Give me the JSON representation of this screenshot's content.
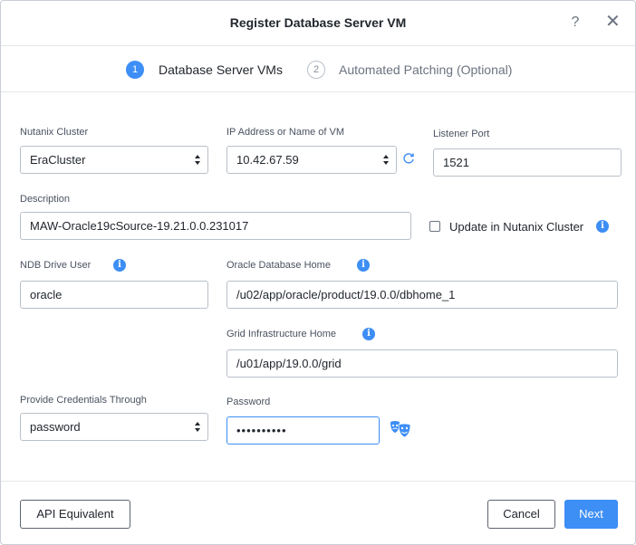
{
  "dialog": {
    "title": "Register Database Server VM",
    "help": "?",
    "close": "✕"
  },
  "steps": [
    {
      "number": "1",
      "label": "Database Server VMs",
      "active": true
    },
    {
      "number": "2",
      "label": "Automated Patching (Optional)",
      "active": false
    }
  ],
  "form": {
    "cluster": {
      "label": "Nutanix Cluster",
      "value": "EraCluster"
    },
    "ip": {
      "label": "IP Address or Name of VM",
      "value": "10.42.67.59"
    },
    "listener": {
      "label": "Listener Port",
      "value": "1521"
    },
    "description": {
      "label": "Description",
      "value": "MAW-Oracle19cSource-19.21.0.0.231017"
    },
    "update_cluster": {
      "label": "Update in Nutanix Cluster",
      "checked": false
    },
    "drive_user": {
      "label": "NDB Drive User",
      "value": "oracle"
    },
    "db_home": {
      "label": "Oracle Database Home",
      "value": "/u02/app/oracle/product/19.0.0/dbhome_1"
    },
    "grid_home": {
      "label": "Grid Infrastructure Home",
      "value": "/u01/app/19.0.0/grid"
    },
    "credentials": {
      "label": "Provide Credentials Through",
      "value": "password"
    },
    "password": {
      "label": "Password",
      "value": "••••••••••"
    }
  },
  "footer": {
    "api_label": "API Equivalent",
    "cancel_label": "Cancel",
    "next_label": "Next"
  },
  "colors": {
    "accent": "#3d8ef5",
    "border": "#b9c0c9"
  },
  "icons": {
    "info": "info-icon",
    "refresh": "refresh-icon",
    "mask": "show-password-icon"
  }
}
